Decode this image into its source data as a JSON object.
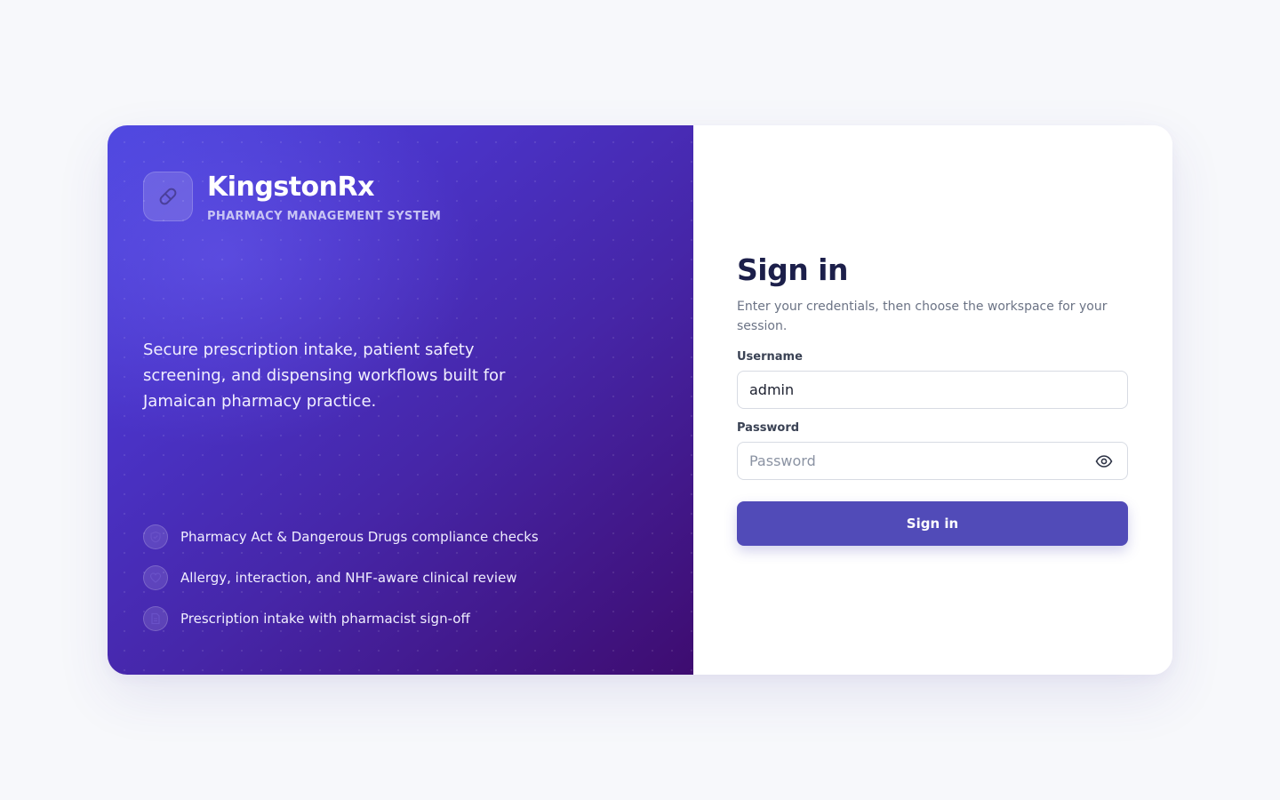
{
  "brand": {
    "name": "KingstonRx",
    "subtitle": "PHARMACY MANAGEMENT SYSTEM",
    "logo_icon": "pill-icon"
  },
  "hero": {
    "tagline": "Secure prescription intake, patient safety screening, and dispensing workflows built for Jamaican pharmacy practice."
  },
  "features": [
    {
      "icon": "shield-check-icon",
      "label": "Pharmacy Act & Dangerous Drugs compliance checks"
    },
    {
      "icon": "heart-icon",
      "label": "Allergy, interaction, and NHF-aware clinical review"
    },
    {
      "icon": "document-icon",
      "label": "Prescription intake with pharmacist sign-off"
    }
  ],
  "signin": {
    "title": "Sign in",
    "subtitle": "Enter your credentials, then choose the workspace for your session.",
    "username_label": "Username",
    "username_value": "admin",
    "password_label": "Password",
    "password_placeholder": "Password",
    "password_value": "",
    "submit_label": "Sign in"
  },
  "colors": {
    "accent": "#514bb8",
    "panel_start": "#4d46df",
    "panel_end": "#3e0c70",
    "heading": "#1c1f4a"
  }
}
